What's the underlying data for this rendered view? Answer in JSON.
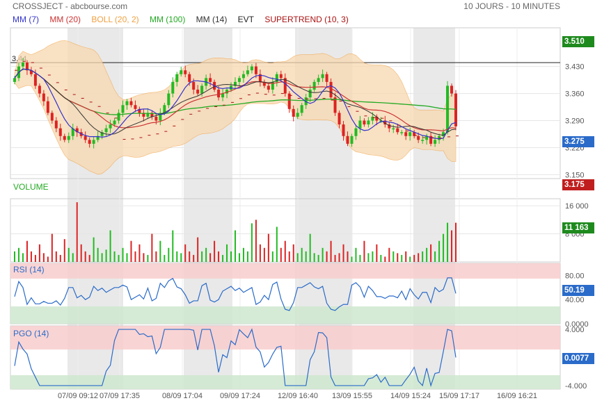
{
  "header": {
    "title": "CROSSJECT - abcbourse.com",
    "period": "10 JOURS - 10 MINUTES"
  },
  "legend": [
    {
      "label": "MM (7)",
      "color": "#3333cc"
    },
    {
      "label": "MM (20)",
      "color": "#cc3333"
    },
    {
      "label": "BOLL (20, 2)",
      "color": "#f0a040"
    },
    {
      "label": "MM (100)",
      "color": "#22aa22"
    },
    {
      "label": "MM (14)",
      "color": "#333333"
    },
    {
      "label": "EVT",
      "color": "#333333"
    },
    {
      "label": "SUPERTREND (10, 3)",
      "color": "#aa1111"
    }
  ],
  "panels": {
    "volume_label": "VOLUME",
    "rsi_label": "RSI (14)",
    "pgo_label": "PGO (14)"
  },
  "badges": {
    "price_top": {
      "text": "3.510",
      "color": "#1e8a1e"
    },
    "price_last": {
      "text": "3.275",
      "color": "#2a6bc9"
    },
    "price_low": {
      "text": "3.175",
      "color": "#c01e1e"
    },
    "volume_last": {
      "text": "11 163",
      "color": "#1e8a1e"
    },
    "rsi_last": {
      "text": "50.19",
      "color": "#2a6bc9"
    },
    "pgo_last": {
      "text": "0.0077",
      "color": "#2a6bc9"
    }
  },
  "colors": {
    "up": "#22bb22",
    "down": "#dd2222",
    "boll_fill": "#f8d8b0",
    "shade": "#e4e4e4"
  },
  "chart_data": [
    {
      "type": "candlestick",
      "title": "CROSSJECT",
      "x_ticks": [
        "07/09 09:12",
        "07/09 17:35",
        "08/09 17:04",
        "09/09 17:24",
        "12/09 16:40",
        "13/09 15:55",
        "14/09 15:24",
        "15/09 17:17",
        "16/09 16:21"
      ],
      "y_ticks": [
        3.15,
        3.22,
        3.29,
        3.36,
        3.43
      ],
      "ylim": [
        3.14,
        3.53
      ],
      "reference_line": {
        "value": 3.44,
        "label": "3.44"
      },
      "last": 3.275,
      "close": [
        3.4,
        3.43,
        3.44,
        3.42,
        3.41,
        3.38,
        3.36,
        3.34,
        3.31,
        3.29,
        3.27,
        3.25,
        3.24,
        3.25,
        3.27,
        3.26,
        3.25,
        3.24,
        3.23,
        3.24,
        3.25,
        3.26,
        3.27,
        3.28,
        3.29,
        3.31,
        3.33,
        3.34,
        3.33,
        3.32,
        3.31,
        3.3,
        3.31,
        3.3,
        3.29,
        3.31,
        3.33,
        3.36,
        3.39,
        3.41,
        3.42,
        3.41,
        3.39,
        3.37,
        3.36,
        3.38,
        3.4,
        3.39,
        3.37,
        3.35,
        3.36,
        3.37,
        3.38,
        3.39,
        3.4,
        3.41,
        3.42,
        3.43,
        3.41,
        3.39,
        3.38,
        3.37,
        3.39,
        3.41,
        3.4,
        3.36,
        3.32,
        3.3,
        3.31,
        3.33,
        3.35,
        3.37,
        3.39,
        3.4,
        3.41,
        3.39,
        3.35,
        3.31,
        3.28,
        3.25,
        3.23,
        3.25,
        3.27,
        3.29,
        3.28,
        3.29,
        3.3,
        3.29,
        3.29,
        3.28,
        3.27,
        3.27,
        3.26,
        3.26,
        3.25,
        3.26,
        3.25,
        3.24,
        3.24,
        3.25,
        3.23,
        3.24,
        3.25,
        3.26,
        3.38,
        3.36,
        3.275
      ],
      "volume_ticks": [
        8000,
        16000
      ],
      "volume_last": 11163,
      "volume": [
        3000,
        4000,
        2500,
        6000,
        3000,
        2000,
        5000,
        2500,
        1500,
        8000,
        3000,
        2000,
        6500,
        4000,
        2500,
        17000,
        5000,
        3000,
        2000,
        7000,
        4000,
        2500,
        3500,
        9000,
        3000,
        2000,
        4000,
        2500,
        6000,
        3000,
        5000,
        2500,
        2000,
        8000,
        3000,
        6000,
        2000,
        4000,
        9000,
        3000,
        2500,
        5000,
        3000,
        2000,
        7000,
        3000,
        4000,
        2500,
        6000,
        3000,
        2000,
        5000,
        3000,
        9000,
        2500,
        4000,
        3000,
        11000,
        12000,
        5000,
        4000,
        8000,
        3000,
        10000,
        4000,
        6000,
        3000,
        5000,
        2500,
        4000,
        3000,
        8000,
        2500,
        2000,
        4000,
        3000,
        6000,
        2000,
        2500,
        5000,
        3000,
        1500,
        4000,
        2000,
        6000,
        2500,
        3000,
        5000,
        2000,
        1500,
        4000,
        3000,
        2500,
        2000,
        3000,
        1500,
        2000,
        2500,
        3000,
        4000,
        5000,
        3000,
        6000,
        8000,
        11163,
        9000,
        11163
      ],
      "rsi_ticks": [
        0,
        40,
        80
      ],
      "rsi_last": 50.19,
      "pgo_ticks": [
        -4,
        0,
        4
      ],
      "pgo_last": 0.0077
    }
  ]
}
